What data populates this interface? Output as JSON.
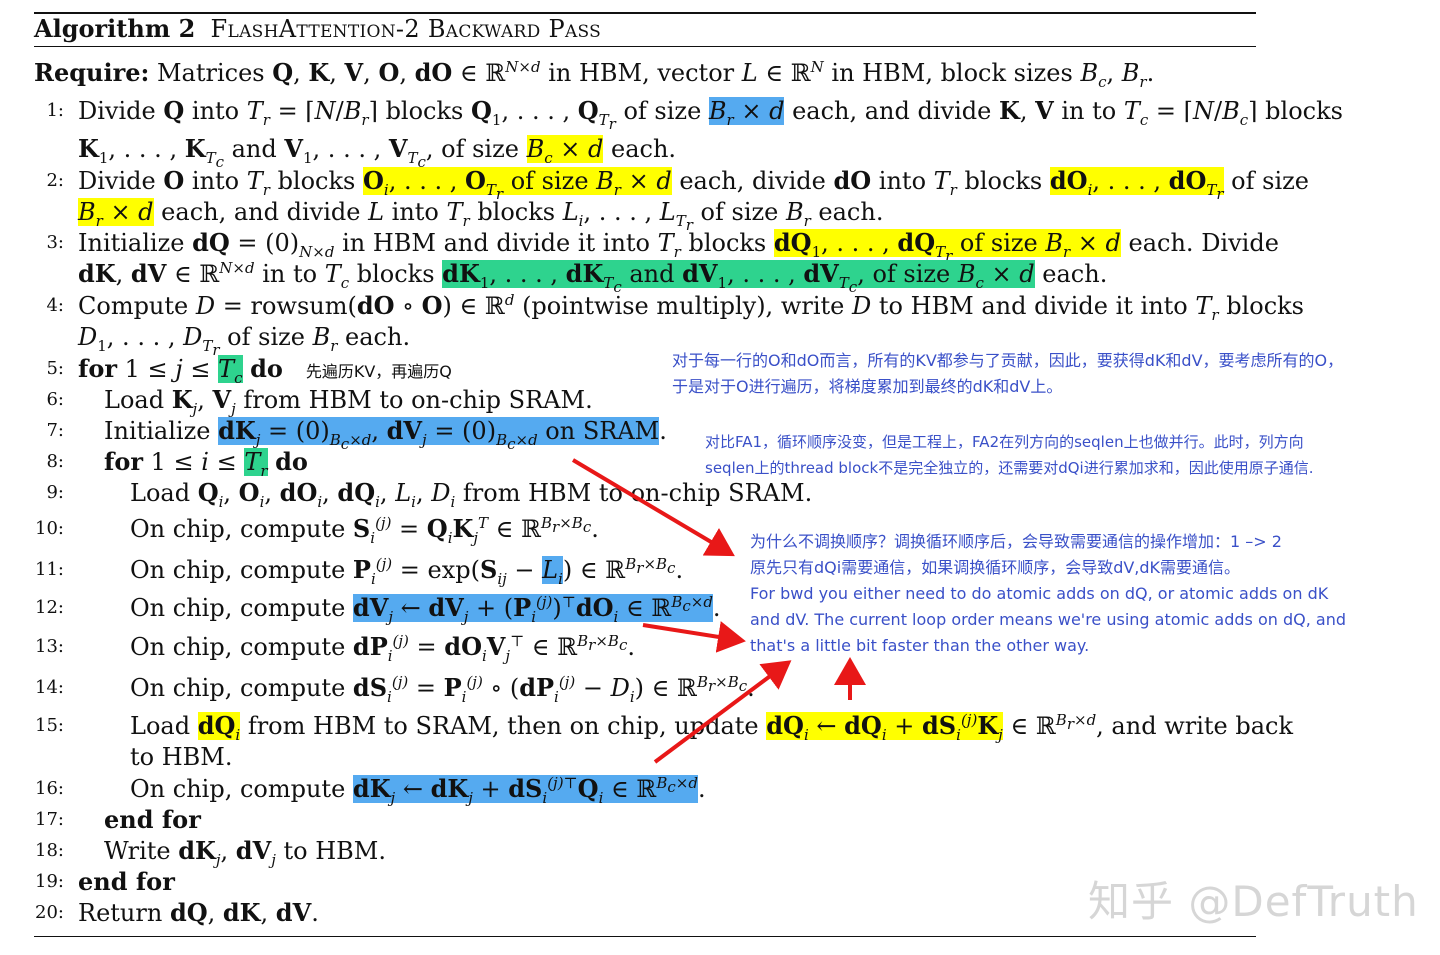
{
  "algorithm": {
    "label": "Algorithm 2",
    "name": "FlashAttention-2 Backward Pass"
  },
  "require": {
    "keyword": "Require:",
    "text": "Matrices Q, K, V, O, dO ∈ ℝ^{N×d} in HBM, vector L ∈ ℝ^N in HBM, block sizes B_c, B_r."
  },
  "steps": [
    {
      "n": "1:",
      "lines": [
        "Divide Q into T_r = ⌈N/B_r⌉ blocks Q_1, . . . , Q_{T_r} of size B_r × d each, and divide K, V in to T_c = ⌈N/B_c⌉ blocks",
        "K_1, . . . , K_{T_c} and V_1, . . . , V_{T_c}, of size B_c × d each."
      ]
    },
    {
      "n": "2:",
      "lines": [
        "Divide O into T_r blocks O_i, . . . , O_{T_r} of size B_r × d each, divide dO into T_r blocks dO_i, . . . , dO_{T_r} of size",
        "B_r × d each, and divide L into T_r blocks L_i, . . . , L_{T_r} of size B_r each."
      ]
    },
    {
      "n": "3:",
      "lines": [
        "Initialize dQ = (0)_{N×d} in HBM and divide it into T_r blocks dQ_1, . . . , dQ_{T_r} of size B_r × d each. Divide",
        "dK, dV ∈ ℝ^{N×d} in to T_c blocks dK_1, . . . , dK_{T_c} and dV_1, . . . , dV_{T_c}, of size B_c × d each."
      ]
    },
    {
      "n": "4:",
      "lines": [
        "Compute D = rowsum(dO ∘ O) ∈ ℝ^d (pointwise multiply), write D to HBM and divide it into T_r blocks",
        "D_1, . . . , D_{T_r} of size B_r each."
      ]
    },
    {
      "n": "5:",
      "lines": [
        "for 1 ≤ j ≤ T_c do"
      ]
    },
    {
      "n": "6:",
      "lines": [
        "Load K_j, V_j from HBM to on-chip SRAM."
      ]
    },
    {
      "n": "7:",
      "lines": [
        "Initialize dK_j = (0)_{B_c×d}, dV_j = (0)_{B_c×d} on SRAM."
      ]
    },
    {
      "n": "8:",
      "lines": [
        "for 1 ≤ i ≤ T_r do"
      ]
    },
    {
      "n": "9:",
      "lines": [
        "Load Q_i, O_i, dO_i, dQ_i, L_i, D_i from HBM to on-chip SRAM."
      ]
    },
    {
      "n": "10:",
      "lines": [
        "On chip, compute S_i^(j) = Q_i K_j^T ∈ ℝ^{B_r×B_c}."
      ]
    },
    {
      "n": "11:",
      "lines": [
        "On chip, compute P_i^(j) = exp(S_ij − L_i) ∈ ℝ^{B_r×B_c}."
      ]
    },
    {
      "n": "12:",
      "lines": [
        "On chip, compute dV_j ← dV_j + (P_i^(j))^⊤ dO_i ∈ ℝ^{B_c×d}."
      ]
    },
    {
      "n": "13:",
      "lines": [
        "On chip, compute dP_i^(j) = dO_i V_j^⊤ ∈ ℝ^{B_r×B_c}."
      ]
    },
    {
      "n": "14:",
      "lines": [
        "On chip, compute dS_i^(j) = P_i^(j) ∘ (dP_i^(j) − D_i) ∈ ℝ^{B_r×B_c}."
      ]
    },
    {
      "n": "15:",
      "lines": [
        "Load dQ_i from HBM to SRAM, then on chip, update dQ_i ← dQ_i + dS_i^(j) K_j ∈ ℝ^{B_r×d}, and write back",
        "to HBM."
      ]
    },
    {
      "n": "16:",
      "lines": [
        "On chip, compute dK_j ← dK_j + dS_i^(j)⊤ Q_i ∈ ℝ^{B_c×d}."
      ]
    },
    {
      "n": "17:",
      "lines": [
        "end for"
      ]
    },
    {
      "n": "18:",
      "lines": [
        "Write dK_j, dV_j to HBM."
      ]
    },
    {
      "n": "19:",
      "lines": [
        "end for"
      ]
    },
    {
      "n": "20:",
      "lines": [
        "Return dQ, dK, dV."
      ]
    }
  ],
  "annotations": {
    "inline_note": "先遍历KV，再遍历Q",
    "note1": [
      "对于每一行的O和dO而言，所有的KV都参与了贡献，因此，要获得dK和dV，要考虑所有的O，",
      "于是对于O进行遍历，将梯度累加到最终的dK和dV上。"
    ],
    "note2": [
      "对比FA1，循环顺序没变，但是工程上，FA2在列方向的seqlen上也做并行。此时，列方向",
      "seqlen上的thread block不是完全独立的，还需要对dQi进行累加求和，因此使用原子通信."
    ],
    "note3": [
      "为什么不调换顺序？调换循环顺序后，会导致需要通信的操作增加：1 –> 2",
      "原先只有dQi需要通信，如果调换循环顺序，会导致dV,dK需要通信。",
      "For bwd you either need to do atomic adds on dQ, or atomic adds on dK",
      "and dV. The current loop order means we're using atomic adds on dQ, and",
      "that's a little bit faster than the other way."
    ]
  },
  "watermark": "知乎 @DefTruth",
  "colors": {
    "highlight_yellow": "#ffff00",
    "highlight_blue": "#55aaf0",
    "highlight_green": "#2ed38e",
    "note_blue": "#3a50c8",
    "arrow_red": "#e81818"
  }
}
